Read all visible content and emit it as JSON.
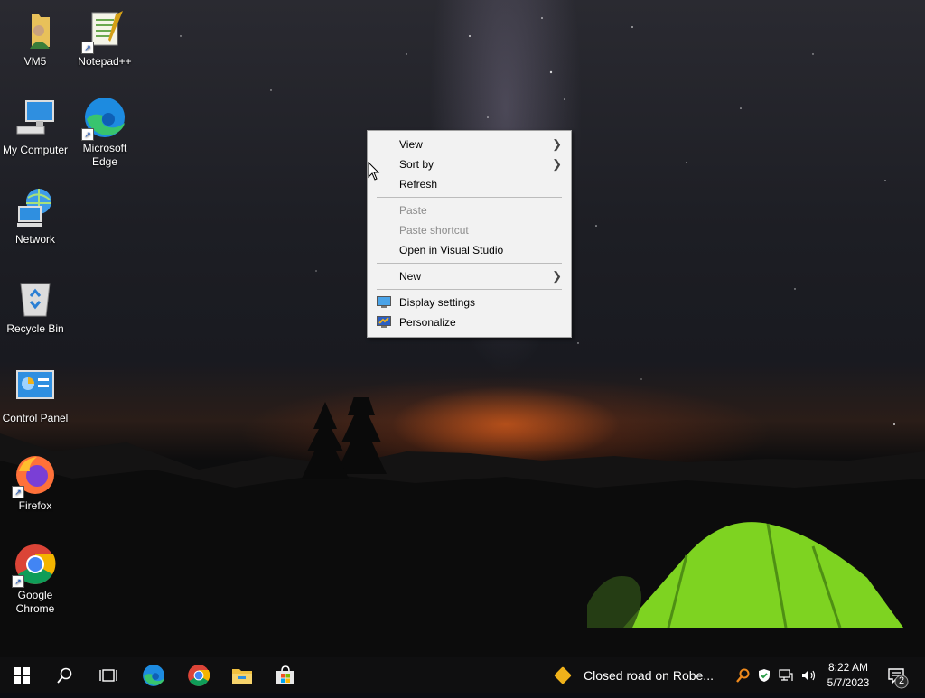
{
  "desktop": {
    "icons": [
      {
        "label": "VM5",
        "icon": "folder-user-icon"
      },
      {
        "label": "Notepad++",
        "icon": "notepadpp-icon"
      },
      {
        "label": "My Computer",
        "icon": "computer-icon"
      },
      {
        "label": "Microsoft Edge",
        "icon": "edge-icon"
      },
      {
        "label": "Network",
        "icon": "network-icon"
      },
      {
        "label": "Recycle Bin",
        "icon": "recycle-bin-icon"
      },
      {
        "label": "Control Panel",
        "icon": "control-panel-icon"
      },
      {
        "label": "Firefox",
        "icon": "firefox-icon"
      },
      {
        "label": "Google Chrome",
        "icon": "chrome-icon"
      }
    ]
  },
  "context_menu": {
    "view": "View",
    "sort_by": "Sort by",
    "refresh": "Refresh",
    "paste": "Paste",
    "paste_shortcut": "Paste shortcut",
    "open_in_vs": "Open in Visual Studio",
    "new": "New",
    "display_settings": "Display settings",
    "personalize": "Personalize"
  },
  "taskbar": {
    "pinned": [
      "start-icon",
      "search-icon",
      "task-view-icon",
      "edge-icon",
      "chrome-icon",
      "file-explorer-icon",
      "store-icon"
    ],
    "news_text": "Closed road on Robe...",
    "time": "8:22 AM",
    "date": "5/7/2023",
    "notification_count": "2"
  },
  "colors": {
    "menu_bg": "#f2f2f2",
    "taskbar_bg": "#0f0f10",
    "tent_green": "#7ed321",
    "news_badge": "#f0b21a"
  }
}
